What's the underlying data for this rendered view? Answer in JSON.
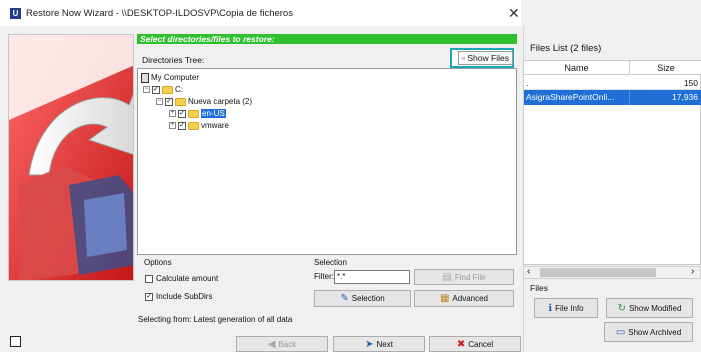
{
  "window": {
    "title": "Restore Now Wizard - \\\\DESKTOP-ILDOSVP\\Copia de ficheros",
    "app_icon_letter": "U",
    "close_glyph": "✕"
  },
  "wizard": {
    "header": "Select directories/files to restore:",
    "tree_label": "Directories Tree:",
    "show_files_label": "Show Files",
    "tree": [
      {
        "label": "My Computer",
        "checked": false,
        "expander": "",
        "icon": "computer"
      },
      {
        "label": "C:",
        "checked": true,
        "expander": "−",
        "icon": "drive"
      },
      {
        "label": "Nueva carpeta (2)",
        "checked": true,
        "expander": "−",
        "icon": "folder"
      },
      {
        "label": "en-US",
        "checked": true,
        "expander": "+",
        "icon": "folder",
        "selected": true
      },
      {
        "label": "vmware",
        "checked": true,
        "expander": "+",
        "icon": "folder"
      }
    ],
    "options": {
      "label": "Options",
      "calculate_amount": {
        "label": "Calculate amount",
        "checked": false
      },
      "include_subdirs": {
        "label": "Include SubDirs",
        "checked": true
      }
    },
    "selection": {
      "label": "Selection",
      "filter_label": "Filter:",
      "filter_value": "*.*",
      "find_file_label": "Find File",
      "selection_button_label": "Selection",
      "advanced_button_label": "Advanced"
    },
    "status": "Selecting from: Latest generation of all data",
    "nav": {
      "back_label": "Back",
      "next_label": "Next",
      "cancel_label": "Cancel"
    }
  },
  "files_panel": {
    "title": "Files List (2 files)",
    "columns": {
      "name": "Name",
      "size": "Size"
    },
    "rows": [
      {
        "name": ".",
        "size": "150",
        "selected": false
      },
      {
        "name": "AsigraSharePointOnli...",
        "size": "17,936",
        "selected": true
      }
    ],
    "files_label": "Files",
    "file_info_label": "File Info",
    "show_modified_label": "Show Modified",
    "show_archived_label": "Show Archived"
  }
}
